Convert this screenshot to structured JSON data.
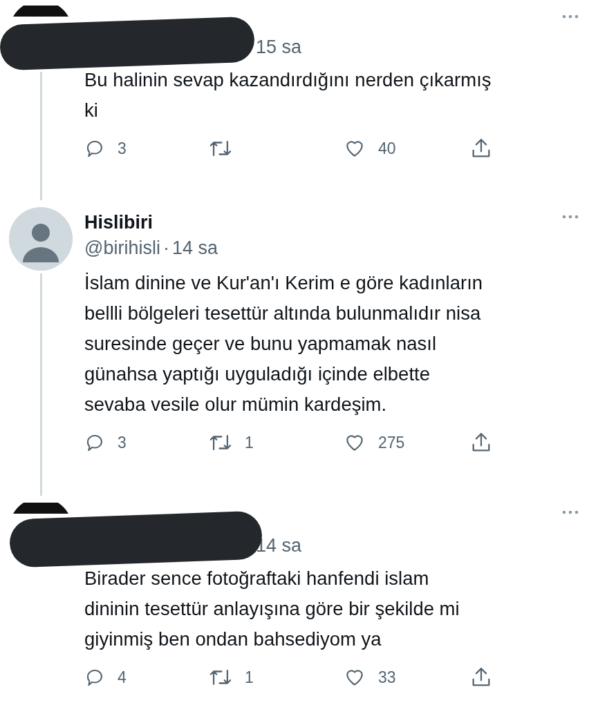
{
  "tweets": [
    {
      "kind": "redacted",
      "time": "15 sa",
      "lines": [
        "Bu halinin sevap kazandırdığını nerden çıkarmış",
        "ki"
      ],
      "replies": "3",
      "likes": "40",
      "connected": true
    },
    {
      "kind": "normal",
      "name": "Hislibiri",
      "handle": "@birihisli",
      "separator": "·",
      "time": "14 sa",
      "lines": [
        "İslam dinine ve Kur'an'ı Kerim e göre kadınların",
        "bellli bölgeleri tesettür altında bulunmalıdır nisa",
        "suresinde geçer ve bunu yapmamak nasıl",
        "günahsa yaptığı uyguladığı içinde elbette",
        "sevaba vesile olur mümin kardeşim."
      ],
      "replies": "3",
      "retweets": "1",
      "likes": "275",
      "connected": true
    },
    {
      "kind": "redacted",
      "time": "14 sa",
      "lines": [
        "Birader sence fotoğraftaki hanfendi islam",
        "dininin tesettür anlayışına göre bir şekilde mi",
        "giyinmiş ben ondan bahsediyom ya"
      ],
      "replies": "4",
      "retweets": "1",
      "likes": "33",
      "connected": false
    }
  ]
}
